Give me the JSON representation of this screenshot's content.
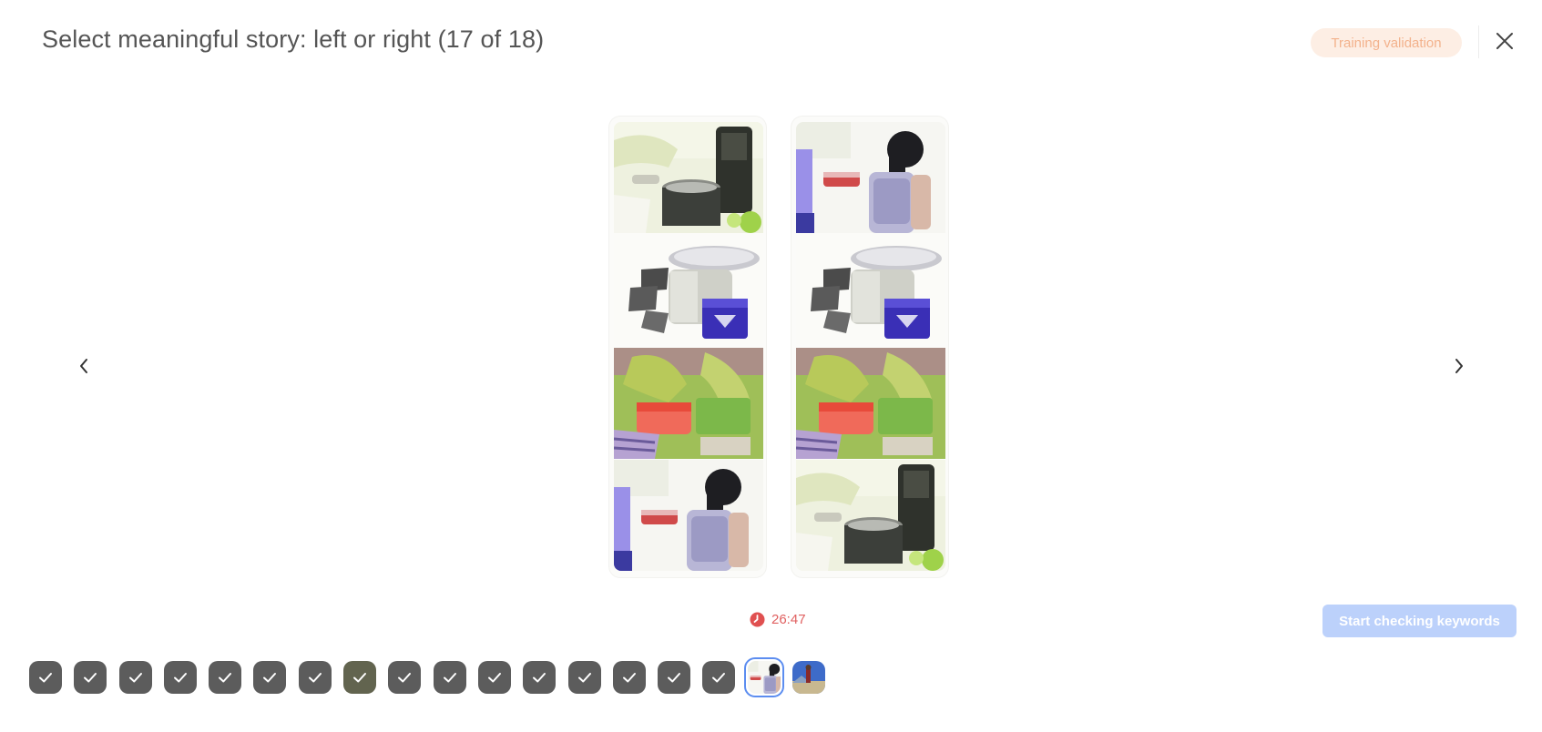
{
  "header": {
    "title": "Select meaningful story: left or right (17 of 18)",
    "badge": "Training validation"
  },
  "icons": {
    "close": "close-icon",
    "prev": "chevron-left-icon",
    "next": "chevron-right-icon",
    "timer": "clock-icon",
    "check": "check-icon"
  },
  "story": {
    "left_frames": [
      "cooking-pot",
      "appliance-and-bag",
      "packing-lunch",
      "girl-with-backpack"
    ],
    "right_frames": [
      "girl-with-backpack",
      "appliance-and-bag",
      "packing-lunch",
      "cooking-pot"
    ]
  },
  "timer": {
    "value": "26:47"
  },
  "actions": {
    "start_label": "Start checking keywords"
  },
  "progress": {
    "total": 18,
    "completed": 16,
    "current": 17
  },
  "colors": {
    "accent_blue": "#5c8df0",
    "button_disabled": "#bcd1fb",
    "badge_bg": "#fdeee4",
    "badge_text": "#f3b28c",
    "timer_red": "#e06060",
    "step_done": "#5c5c5c"
  }
}
